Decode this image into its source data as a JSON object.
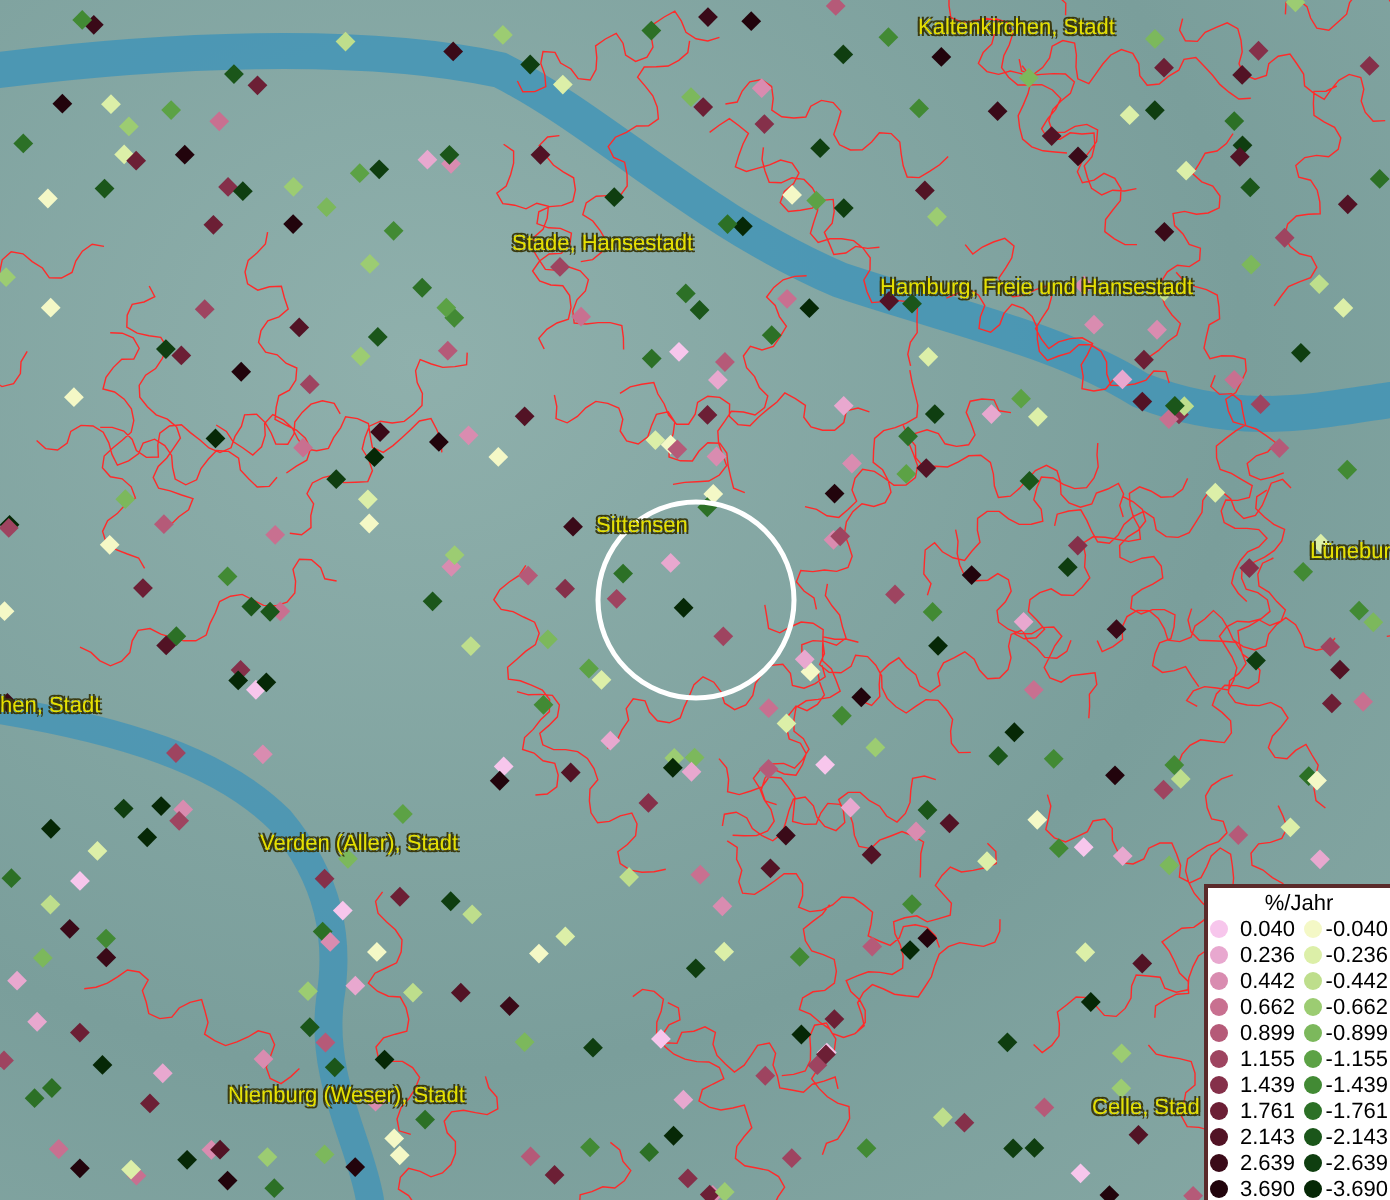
{
  "map": {
    "places": [
      {
        "name": "Kaltenkirchen, Stadt"
      },
      {
        "name": "Stade, Hansestadt"
      },
      {
        "name": "Hamburg, Freie und Hansestadt"
      },
      {
        "name": "Sittensen"
      },
      {
        "name": "Lünebur"
      },
      {
        "name": "hen, Stadt"
      },
      {
        "name": "Verden (Aller), Stadt"
      },
      {
        "name": "Nienburg (Weser), Stadt"
      },
      {
        "name": "Celle, Stad"
      }
    ]
  },
  "legend": {
    "title": "%/Jahr",
    "positive": [
      {
        "value": "0.040",
        "color": "#f7c6ec"
      },
      {
        "value": "0.236",
        "color": "#e8a8cf"
      },
      {
        "value": "0.442",
        "color": "#d98cb0"
      },
      {
        "value": "0.662",
        "color": "#c87090"
      },
      {
        "value": "0.899",
        "color": "#b55a78"
      },
      {
        "value": "1.155",
        "color": "#9e4460"
      },
      {
        "value": "1.439",
        "color": "#85304a"
      },
      {
        "value": "1.761",
        "color": "#6c1f35"
      },
      {
        "value": "2.143",
        "color": "#521325"
      },
      {
        "value": "2.639",
        "color": "#3a0a18"
      },
      {
        "value": "3.690",
        "color": "#22040c"
      }
    ],
    "negative": [
      {
        "value": "-0.040",
        "color": "#f4f8c6"
      },
      {
        "value": "-0.236",
        "color": "#dcefa8"
      },
      {
        "value": "-0.442",
        "color": "#bede8c"
      },
      {
        "value": "-0.662",
        "color": "#9ccc72"
      },
      {
        "value": "-0.899",
        "color": "#7cb85c"
      },
      {
        "value": "-1.155",
        "color": "#5ca245"
      },
      {
        "value": "-1.439",
        "color": "#428a34"
      },
      {
        "value": "-1.761",
        "color": "#2c7026"
      },
      {
        "value": "-2.143",
        "color": "#1b561a"
      },
      {
        "value": "-2.639",
        "color": "#0f3e10"
      },
      {
        "value": "-3.690",
        "color": "#062806"
      }
    ]
  }
}
